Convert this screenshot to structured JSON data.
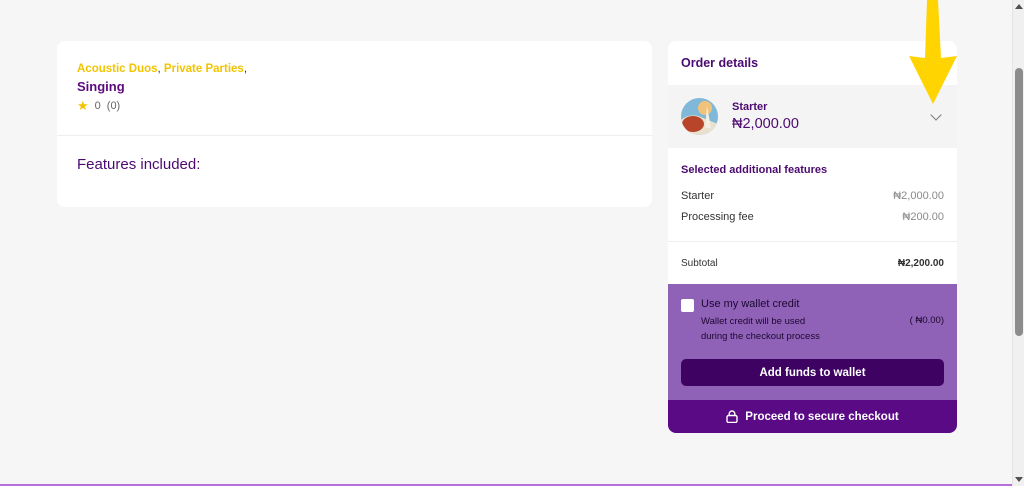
{
  "listing": {
    "tags": [
      "Acoustic Duos",
      "Private Parties"
    ],
    "tag_separator": ",",
    "category": "Singing",
    "rating_value": "0",
    "rating_count": "(0)",
    "features_title": "Features included:"
  },
  "order": {
    "header": "Order details",
    "package": {
      "name": "Starter",
      "price": "₦2,000.00"
    },
    "features_heading": "Selected additional features",
    "lines": [
      {
        "label": "Starter",
        "value": "₦2,000.00"
      },
      {
        "label": "Processing fee",
        "value": "₦200.00"
      }
    ],
    "subtotal_label": "Subtotal",
    "subtotal_value": "₦2,200.00",
    "wallet": {
      "checkbox_label": "Use my wallet credit",
      "description_line1": "Wallet credit will be used",
      "description_line2": "during the checkout process",
      "amount": "( ₦0.00)",
      "checked": false
    },
    "add_funds_label": "Add funds to wallet",
    "checkout_label": "Proceed to secure checkout"
  },
  "colors": {
    "accent_purple": "#4b0a70",
    "tag_yellow": "#f2c400",
    "wallet_bg": "#8f62b8",
    "button_dark": "#3d0262",
    "checkout_bg": "#5a0a85",
    "annotation_arrow": "#ffd400"
  },
  "icons": {
    "star": "star-icon",
    "chevron": "chevron-down-icon",
    "lock": "lock-icon",
    "arrow": "arrow-down-annotation"
  }
}
